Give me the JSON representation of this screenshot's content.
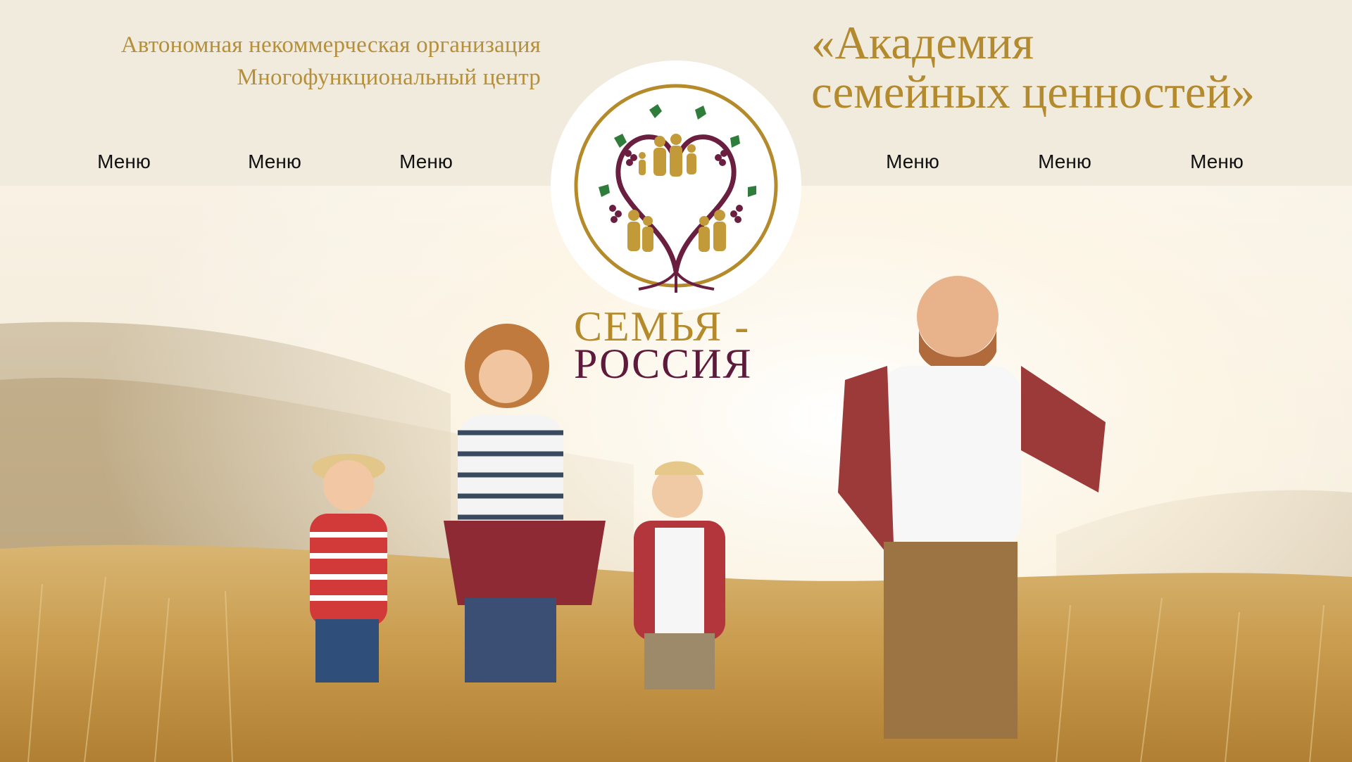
{
  "header": {
    "org_line_1": "Автономная некоммерческая организация",
    "org_line_2": "Многофункциональный центр",
    "academy_line_1": "«Академия",
    "academy_line_2": "семейных ценностей»"
  },
  "nav": {
    "left": [
      {
        "label": "Меню"
      },
      {
        "label": "Меню"
      },
      {
        "label": "Меню"
      }
    ],
    "right": [
      {
        "label": "Меню"
      },
      {
        "label": "Меню"
      },
      {
        "label": "Меню"
      }
    ]
  },
  "logo": {
    "title_line_1": "СЕМЬЯ -",
    "title_line_2": "РОССИЯ",
    "icon": "family-tree-icon"
  },
  "hero": {
    "image": "family-running-in-field-photo"
  },
  "colors": {
    "header_bg": "#f1ebdd",
    "gold": "#b58a2b",
    "burgundy": "#5e1a3a",
    "leaf_green": "#2f7d3a"
  }
}
